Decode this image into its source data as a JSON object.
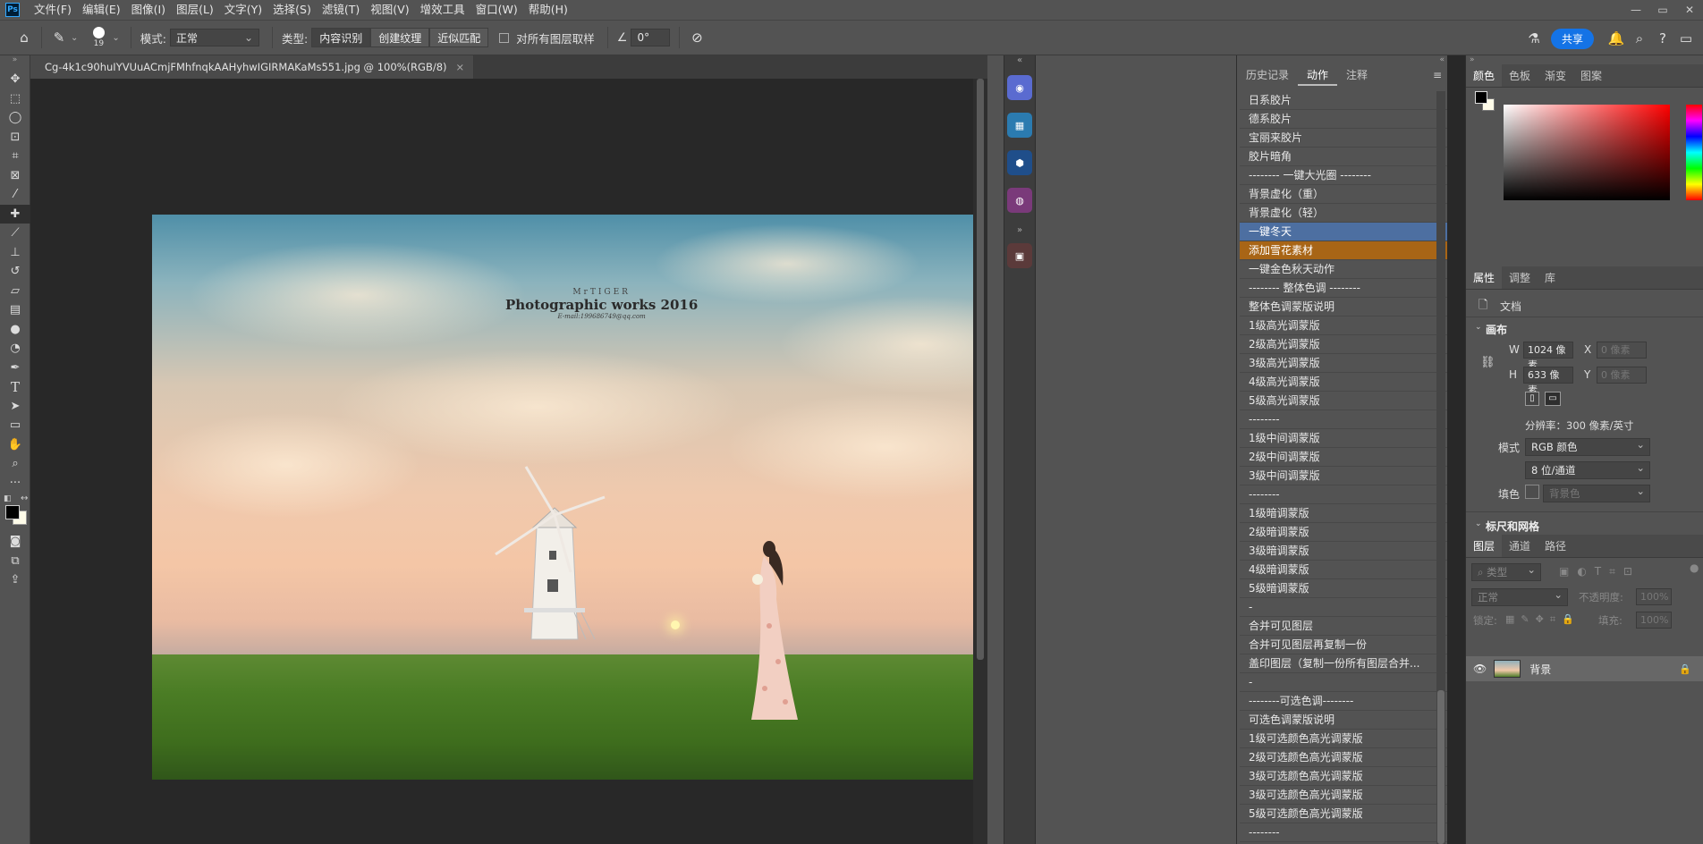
{
  "app": {
    "logo": "Ps"
  },
  "menu": [
    "文件(F)",
    "编辑(E)",
    "图像(I)",
    "图层(L)",
    "文字(Y)",
    "选择(S)",
    "滤镜(T)",
    "视图(V)",
    "增效工具",
    "窗口(W)",
    "帮助(H)"
  ],
  "window_controls": [
    "—",
    "▭",
    "✕"
  ],
  "options": {
    "brush_size": "19",
    "mode_label": "模式:",
    "mode_value": "正常",
    "type_label": "类型:",
    "type_buttons": [
      "内容识别",
      "创建纹理",
      "近似匹配"
    ],
    "sample_all_label": "对所有图层取样",
    "angle_value": "0°",
    "share_label": "共享"
  },
  "document": {
    "tab_title": "Cg-4k1c90huIYVUuACmjFMhfnqkAAHyhwIGIRMAKaMs551.jpg @ 100%(RGB/8)",
    "close": "×"
  },
  "photo": {
    "watermark_top": "MrTIGER",
    "watermark_title": "Photographic works 2016",
    "watermark_email": "E-mail:199686749@qq.com"
  },
  "actions_panel": {
    "tabs": [
      "历史记录",
      "动作",
      "注释"
    ],
    "active_tab": "动作",
    "items": [
      "日系胶片",
      "德系胶片",
      "宝丽来胶片",
      "胶片暗角",
      "-------- 一键大光圈 --------",
      "背景虚化（重）",
      "背景虚化（轻）",
      "一键冬天",
      "添加雪花素材",
      "一键金色秋天动作",
      "-------- 整体色调 --------",
      "整体色调蒙版说明",
      "1级高光调蒙版",
      "2级高光调蒙版",
      "3级高光调蒙版",
      "4级高光调蒙版",
      "5级高光调蒙版",
      "--------",
      "1级中间调蒙版",
      "2级中间调蒙版",
      "3级中间调蒙版",
      "--------",
      "1级暗调蒙版",
      "2级暗调蒙版",
      "3级暗调蒙版",
      "4级暗调蒙版",
      "5级暗调蒙版",
      "-",
      "合并可见图层",
      "合并可见图层再复制一份",
      "盖印图层（复制一份所有图层合并...",
      "-",
      "--------可选色调--------",
      "可选色调蒙版说明",
      "1级可选颜色高光调蒙版",
      "2级可选颜色高光调蒙版",
      "3级可选颜色高光调蒙版",
      "3级可选颜色高光调蒙版",
      "5级可选颜色高光调蒙版",
      "--------"
    ],
    "selected_index": 7,
    "highlight_index": 8
  },
  "color_panel": {
    "tabs": [
      "颜色",
      "色板",
      "渐变",
      "图案"
    ],
    "fg": "#000000",
    "bg": "#fffce9"
  },
  "properties_panel": {
    "tabs": [
      "属性",
      "调整",
      "库"
    ],
    "doc_label": "文档",
    "canvas_section": "画布",
    "w_label": "W",
    "w_value": "1024 像素",
    "h_label": "H",
    "h_value": "633 像素",
    "x_label": "X",
    "x_value": "0 像素",
    "y_label": "Y",
    "y_value": "0 像素",
    "resolution": "分辨率：300 像素/英寸",
    "mode_label": "模式",
    "mode_value": "RGB 颜色",
    "depth_value": "8 位/通道",
    "fill_label": "填色",
    "fill_value": "背景色",
    "rulers_section": "标尺和网格"
  },
  "layers_panel": {
    "tabs": [
      "图层",
      "通道",
      "路径"
    ],
    "filter_placeholder": "类型",
    "blend_mode": "正常",
    "opacity_label": "不透明度:",
    "opacity_value": "100%",
    "lock_label": "锁定:",
    "fill_label": "填充:",
    "fill_value": "100%",
    "layer_name": "背景"
  }
}
